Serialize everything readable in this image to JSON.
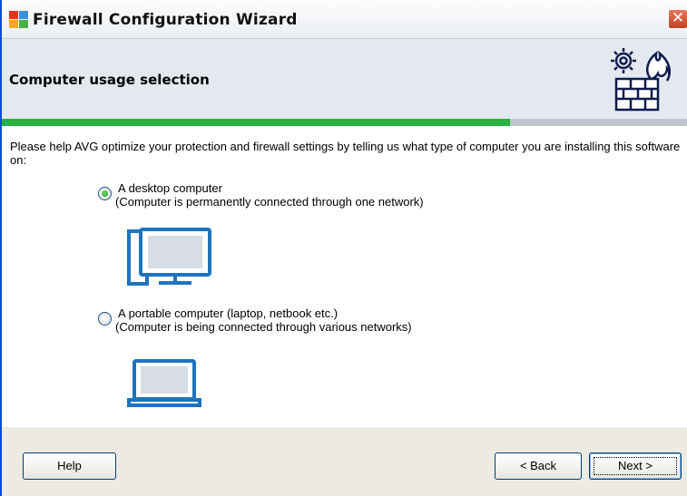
{
  "window": {
    "title": "Firewall Configuration Wizard",
    "close_glyph": "✕"
  },
  "header": {
    "title": "Computer usage selection",
    "icon": "firewall-gear-flame-icon"
  },
  "progress": {
    "fraction": 0.74,
    "color": "#2ab140"
  },
  "intro": "Please help AVG optimize your protection and firewall settings by telling us what type of computer you are installing this software on:",
  "options": [
    {
      "title": "A desktop computer",
      "description": "(Computer is permanently connected through one network)",
      "selected": true,
      "icon": "desktop-computer-icon"
    },
    {
      "title": "A portable computer (laptop, netbook etc.)",
      "description": "(Computer is being connected through various networks)",
      "selected": false,
      "icon": "laptop-icon"
    }
  ],
  "buttons": {
    "help": "Help",
    "back": "< Back",
    "next": "Next >"
  },
  "colors": {
    "accent_blue": "#1e73be",
    "header_bg": "#e4e9f0",
    "footer_bg": "#eceae2"
  }
}
